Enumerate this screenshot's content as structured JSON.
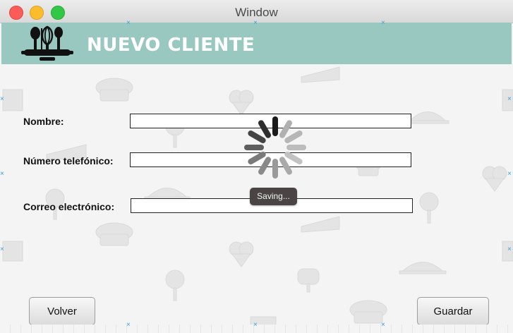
{
  "window": {
    "title": "Window",
    "controls": [
      "close",
      "minimize",
      "maximize"
    ]
  },
  "header": {
    "title": "NUEVO CLIENTE",
    "logo_icon": "bakery-utensils-icon",
    "background": "#99c8c0"
  },
  "form": {
    "fields": [
      {
        "label": "Nombre:",
        "value": ""
      },
      {
        "label": "Número telefónico:",
        "value": ""
      },
      {
        "label": "Correo electrónico:",
        "value": ""
      }
    ]
  },
  "status": {
    "spinner_icon": "loading-spinner-icon",
    "saving_text": "Saving..."
  },
  "buttons": {
    "back_label": "Volver",
    "save_label": "Guardar"
  }
}
